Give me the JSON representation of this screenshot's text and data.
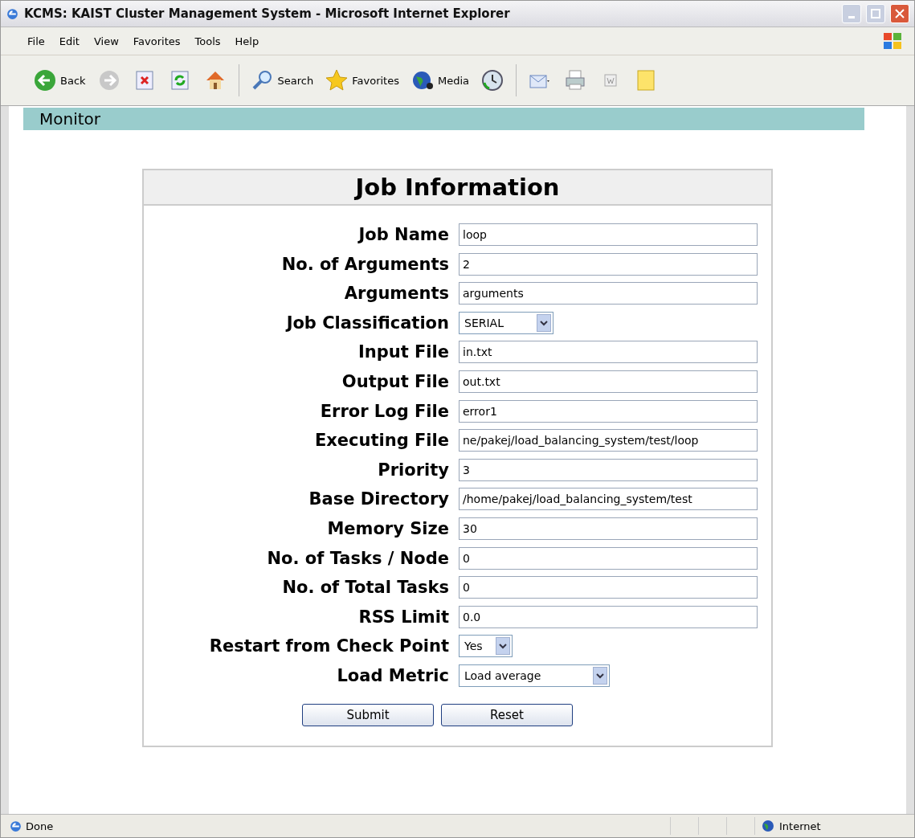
{
  "window": {
    "title": "KCMS: KAIST Cluster Management System - Microsoft Internet Explorer"
  },
  "menu": [
    "File",
    "Edit",
    "View",
    "Favorites",
    "Tools",
    "Help"
  ],
  "toolbar": [
    {
      "kind": "back",
      "label": "Back"
    },
    {
      "kind": "forward"
    },
    {
      "kind": "stop"
    },
    {
      "kind": "refresh"
    },
    {
      "kind": "home"
    },
    {
      "kind": "search",
      "label": "Search"
    },
    {
      "kind": "favorites",
      "label": "Favorites"
    },
    {
      "kind": "media",
      "label": "Media"
    },
    {
      "kind": "history"
    },
    {
      "kind": "mail"
    },
    {
      "kind": "print"
    },
    {
      "kind": "edit"
    },
    {
      "kind": "note"
    }
  ],
  "nav": {
    "title": "Monitor"
  },
  "form": {
    "title": "Job Information",
    "fields": [
      {
        "label": "Job Name",
        "kind": "text",
        "value": "loop"
      },
      {
        "label": "No. of Arguments",
        "kind": "text",
        "value": "2"
      },
      {
        "label": "Arguments",
        "kind": "text",
        "value": "arguments"
      },
      {
        "label": "Job Classification",
        "kind": "select",
        "value": "SERIAL"
      },
      {
        "label": "Input File",
        "kind": "text",
        "value": "in.txt"
      },
      {
        "label": "Output File",
        "kind": "text",
        "value": "out.txt"
      },
      {
        "label": "Error Log File",
        "kind": "text",
        "value": "error1"
      },
      {
        "label": "Executing File",
        "kind": "text",
        "value": "ne/pakej/load_balancing_system/test/loop"
      },
      {
        "label": "Priority",
        "kind": "text",
        "value": "3"
      },
      {
        "label": "Base Directory",
        "kind": "text",
        "value": "/home/pakej/load_balancing_system/test"
      },
      {
        "label": "Memory Size",
        "kind": "text",
        "value": "30"
      },
      {
        "label": "No. of Tasks / Node",
        "kind": "text",
        "value": "0"
      },
      {
        "label": "No. of Total Tasks",
        "kind": "text",
        "value": "0"
      },
      {
        "label": "RSS Limit",
        "kind": "text",
        "value": "0.0"
      },
      {
        "label": "Restart from Check Point",
        "kind": "select",
        "value": "Yes"
      },
      {
        "label": "Load Metric",
        "kind": "select",
        "value": "Load average"
      }
    ],
    "buttons": [
      "Submit",
      "Reset"
    ]
  },
  "status_bar": {
    "text": "Done",
    "zone": "Internet"
  }
}
